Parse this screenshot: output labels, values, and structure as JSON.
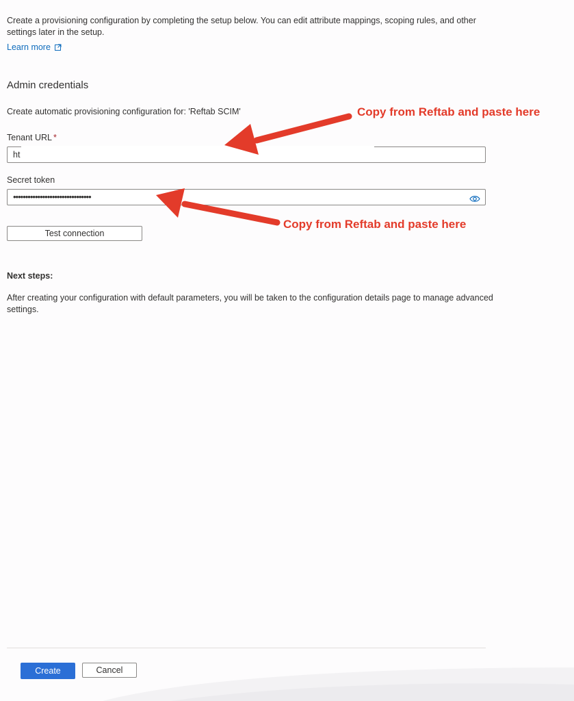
{
  "intro": {
    "description": "Create a provisioning configuration by completing the setup below. You can edit attribute mappings, scoping rules, and other settings later in the setup.",
    "learn_more": "Learn more"
  },
  "admin_credentials": {
    "title": "Admin credentials",
    "provision_for": "Create automatic provisioning configuration for: 'Reftab SCIM'",
    "tenant_url": {
      "label": "Tenant URL",
      "required_marker": "*",
      "value": "ht"
    },
    "secret_token": {
      "label": "Secret token",
      "masked_value": "••••••••••••••••••••••••••••••••"
    },
    "test_connection_label": "Test connection"
  },
  "next_steps": {
    "title": "Next steps:",
    "text": "After creating your configuration with default parameters, you will be taken to the configuration details page to manage advanced settings."
  },
  "footer": {
    "create_label": "Create",
    "cancel_label": "Cancel"
  },
  "annotations": {
    "top": "Copy from Reftab and paste here",
    "bottom": "Copy from Reftab and paste here",
    "color": "#e33b2a"
  },
  "colors": {
    "link": "#0f6cbd",
    "primary_button": "#2b6fd6",
    "required": "#a4262c"
  },
  "icons": {
    "external_link": "external-link-icon",
    "reveal_password": "eye-icon"
  }
}
